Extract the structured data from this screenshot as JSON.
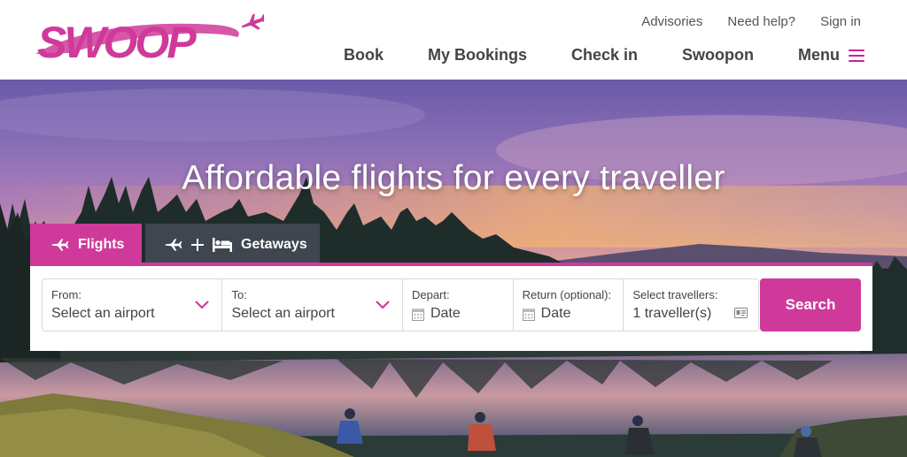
{
  "header": {
    "logo_text": "SWOOP",
    "top_links": [
      "Advisories",
      "Need help?",
      "Sign in"
    ],
    "nav": {
      "book": "Book",
      "my_bookings": "My Bookings",
      "check_in": "Check in",
      "swoopon": "Swoopon",
      "menu": "Menu"
    }
  },
  "hero": {
    "headline": "Affordable flights for every traveller"
  },
  "tabs": {
    "flights": "Flights",
    "getaways": "Getaways"
  },
  "booking": {
    "from_label": "From:",
    "from_placeholder": "Select an airport",
    "to_label": "To:",
    "to_placeholder": "Select an airport",
    "depart_label": "Depart:",
    "depart_value": "Date",
    "return_label": "Return (optional):",
    "return_value": "Date",
    "travellers_label": "Select travellers:",
    "travellers_value": "1 traveller(s)",
    "search_label": "Search"
  },
  "colors": {
    "brand": "#cf3a9a",
    "tab_inactive": "#3f4650",
    "nav_text": "#444444"
  },
  "icons": [
    "airplane-icon",
    "hamburger-menu-icon",
    "bed-icon",
    "chevron-down-icon",
    "calendar-icon",
    "id-card-icon"
  ]
}
